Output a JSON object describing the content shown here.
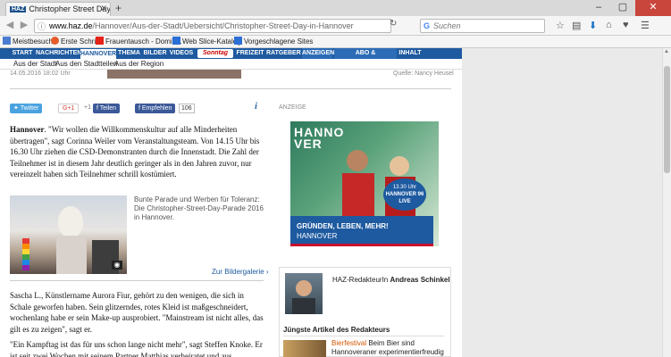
{
  "browser": {
    "tab_favicon": "HAZ",
    "tab_title": "Christopher Street Day in H...",
    "url_domain": "www.haz.de",
    "url_path": "/Hannover/Aus-der-Stadt/Uebersicht/Christopher-Street-Day-in-Hannover",
    "search_placeholder": "Suchen",
    "search_engine_icon": "google-icon"
  },
  "bookmarks": [
    {
      "label": "Meistbesucht",
      "color": "#4a7bd0"
    },
    {
      "label": "Erste Schritte",
      "color": "#e55b2a"
    },
    {
      "label": "Frauentausch - Domin...",
      "color": "#e62117"
    },
    {
      "label": "Web Slice-Katalog",
      "color": "#2b6fd6"
    },
    {
      "label": "Vorgeschlagene Sites",
      "color": "#2b6fd6"
    }
  ],
  "menu": [
    {
      "label": "START"
    },
    {
      "label": "NACHRICHTEN"
    },
    {
      "label": "HANNOVER"
    },
    {
      "label": "THEMA"
    },
    {
      "label": "BILDER"
    },
    {
      "label": "VIDEOS"
    },
    {
      "label": "Sonntag"
    },
    {
      "label": "FREIZEIT"
    },
    {
      "label": "RATGEBER"
    },
    {
      "label": "ANZEIGEN"
    },
    {
      "label": "ABO & LESERSERVICE"
    },
    {
      "label": "INHALT"
    }
  ],
  "submenu": [
    "Aus der Stadt",
    "Aus den Stadtteilen",
    "Aus der Region"
  ],
  "meta": {
    "date": "14.05.2016 18:02 Uhr",
    "photo_source": "Quelle: Nancy Heusel"
  },
  "share": {
    "twitter": "Twitter",
    "gplus": "G+1",
    "gplus_count": "+1",
    "facebook_share": "Teilen",
    "facebook_like": "Empfehlen",
    "like_count": "106",
    "info": "i"
  },
  "article": {
    "lead_city": "Hannover",
    "lead": ". \"Wir wollen die Willkommenskultur auf alle Minderheiten übertragen\", sagt Corinna Weiler vom Veranstaltungsteam. Von 14.15 Uhr bis 16.30 Uhr ziehen die CSD-Demonstranten durch die Innenstadt. Die Zahl der Teilnehmer ist in diesem Jahr deutlich geringer als in den Jahren zuvor, nur vereinzelt haben sich Teilnehmer schrill kostümiert.",
    "caption": "Bunte Parade und Werben für Toleranz: Die Christopher-Street-Day-Parade 2016 in Hannover.",
    "gallery_link": "Zur Bildergalerie",
    "para2": "Sascha L., Künstlername Aurora Fiur, gehört zu den wenigen, die sich in Schale geworfen haben. Sein glitzerndes, rotes Kleid ist maßgeschneidert, wochenlang habe er sein Make-up ausprobiert. \"Mainstream ist nicht alles, das gilt es zu zeigen\", sagt er.",
    "para3": "\"Ein Kampftag ist das für uns schon lange nicht mehr\", sagt Steffen Knoke. Er ist seit zwei Wochen mit seinem Partner Matthias verheiratet und aus"
  },
  "ad": {
    "label": "ANZEIGE",
    "headline": "HANNOVER",
    "badge_line1": "13.30 Uhr",
    "badge_line2": "HANNOVER 96",
    "badge_line3": "LIVE",
    "slogan": "GRÜNDEN, LEBEN, MEHR!",
    "city": "HANNOVER"
  },
  "author": {
    "role": "HAZ-RedakteurIn ",
    "name": "Andreas Schinkel",
    "latest_heading": "Jüngste Artikel des Redakteurs",
    "article_title": "Bierfestival",
    "article_teaser": " Beim Bier sind Hannoveraner experimentierfreudig"
  }
}
